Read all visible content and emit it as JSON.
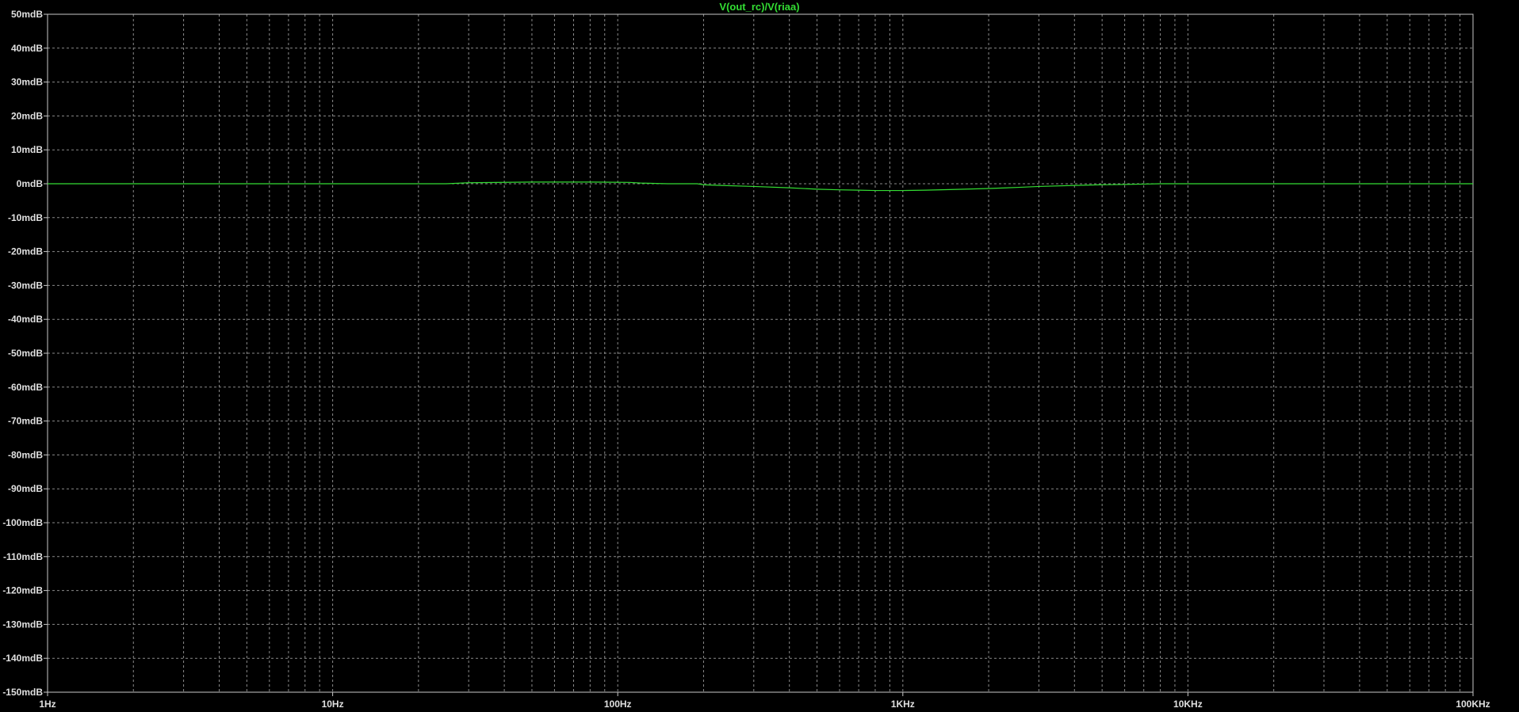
{
  "window": {
    "background": "#000000"
  },
  "chart_data": {
    "type": "line",
    "title": "V(out_rc)/V(riaa)",
    "title_color": "#33dd33",
    "x_scale": "log",
    "xlim": [
      1,
      100000
    ],
    "x_ticks": [
      {
        "value": 1,
        "label": "1Hz"
      },
      {
        "value": 10,
        "label": "10Hz"
      },
      {
        "value": 100,
        "label": "100Hz"
      },
      {
        "value": 1000,
        "label": "1KHz"
      },
      {
        "value": 10000,
        "label": "10KHz"
      },
      {
        "value": 100000,
        "label": "100KHz"
      }
    ],
    "ylim": [
      -150,
      50
    ],
    "y_ticks": [
      {
        "value": 50,
        "label": "50mdB"
      },
      {
        "value": 40,
        "label": "40mdB"
      },
      {
        "value": 30,
        "label": "30mdB"
      },
      {
        "value": 20,
        "label": "20mdB"
      },
      {
        "value": 10,
        "label": "10mdB"
      },
      {
        "value": 0,
        "label": "0mdB"
      },
      {
        "value": -10,
        "label": "-10mdB"
      },
      {
        "value": -20,
        "label": "-20mdB"
      },
      {
        "value": -30,
        "label": "-30mdB"
      },
      {
        "value": -40,
        "label": "-40mdB"
      },
      {
        "value": -50,
        "label": "-50mdB"
      },
      {
        "value": -60,
        "label": "-60mdB"
      },
      {
        "value": -70,
        "label": "-70mdB"
      },
      {
        "value": -80,
        "label": "-80mdB"
      },
      {
        "value": -90,
        "label": "-90mdB"
      },
      {
        "value": -100,
        "label": "-100mdB"
      },
      {
        "value": -110,
        "label": "-110mdB"
      },
      {
        "value": -120,
        "label": "-120mdB"
      },
      {
        "value": -130,
        "label": "-130mdB"
      },
      {
        "value": -140,
        "label": "-140mdB"
      },
      {
        "value": -150,
        "label": "-150mdB"
      }
    ],
    "grid": true,
    "grid_style": "dashed",
    "axis_color": "#c8c8c8",
    "grid_color": "#8a8a8a",
    "label_color": "#e0e0e0",
    "series": [
      {
        "color": "#33dd33",
        "x": [
          1,
          10,
          25,
          30,
          50,
          80,
          110,
          120,
          150,
          190,
          200,
          230,
          300,
          400,
          500,
          600,
          700,
          800,
          900,
          1000,
          1200,
          1500,
          2000,
          2500,
          3000,
          4000,
          5000,
          6000,
          7000,
          8000,
          9000,
          10000,
          20000,
          50000,
          100000
        ],
        "y": [
          0,
          0,
          0,
          0.3,
          0.5,
          0.5,
          0.4,
          0.2,
          0,
          0,
          -0.3,
          -0.5,
          -0.8,
          -1.2,
          -1.6,
          -1.8,
          -1.9,
          -2.0,
          -2.0,
          -2.0,
          -1.9,
          -1.7,
          -1.4,
          -1.1,
          -0.8,
          -0.5,
          -0.3,
          -0.2,
          -0.1,
          0,
          0,
          0,
          0,
          0,
          0
        ]
      }
    ]
  }
}
